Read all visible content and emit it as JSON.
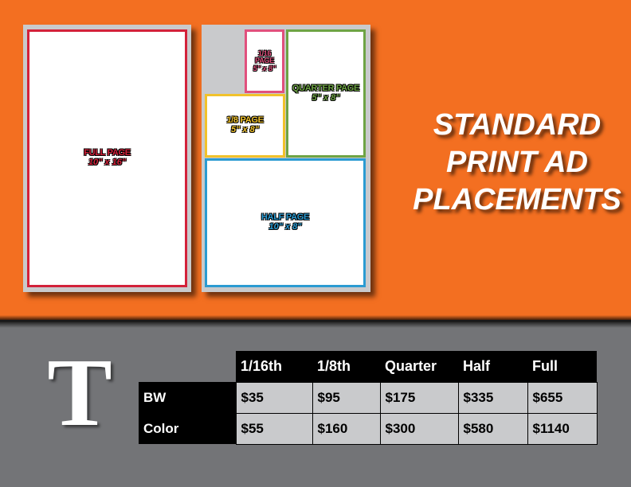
{
  "headline": {
    "lines": [
      "STANDARD",
      "PRINT AD",
      "PLACEMENTS"
    ],
    "color": "#ffffff"
  },
  "colors": {
    "background_top": "#f36f21",
    "background_bottom": "#737477",
    "sheet": "#c9cacc"
  },
  "ad_placements": [
    {
      "id": "full",
      "label": "FULL PAGE",
      "size": "10\" x 16\"",
      "color": "#d3213a"
    },
    {
      "id": "sixteenth",
      "label_lines": [
        "1/16",
        "PAGE"
      ],
      "size": "5\" x 8\"",
      "color": "#e1507d"
    },
    {
      "id": "quarter",
      "label": "QUARTER PAGE",
      "size": "5\" x 8\"",
      "color": "#6ea444"
    },
    {
      "id": "eighth",
      "label": "1/8 PAGE",
      "size": "5\" x 8\"",
      "color": "#f1c22b"
    },
    {
      "id": "half",
      "label": "HALF PAGE",
      "size": "10\" x 8\"",
      "color": "#2b9bd2"
    }
  ],
  "logo": {
    "letter": "T",
    "icon": "newspaper-t-logo"
  },
  "rate_table": {
    "columns": [
      "1/16th",
      "1/8th",
      "Quarter",
      "Half",
      "Full"
    ],
    "rows": [
      {
        "label": "BW",
        "prices": [
          "$35",
          "$95",
          "$175",
          "$335",
          "$655"
        ]
      },
      {
        "label": "Color",
        "prices": [
          "$55",
          "$160",
          "$300",
          "$580",
          "$1140"
        ]
      }
    ]
  }
}
